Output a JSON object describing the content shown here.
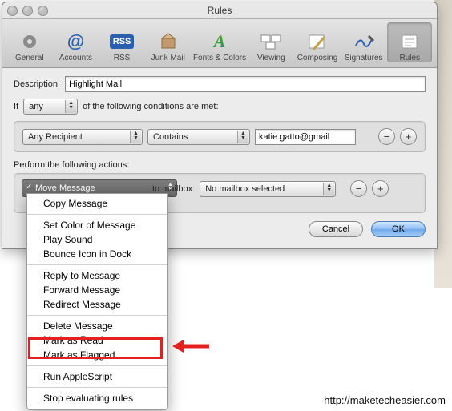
{
  "window": {
    "title": "Rules"
  },
  "toolbar": {
    "items": [
      {
        "label": "General"
      },
      {
        "label": "Accounts"
      },
      {
        "label": "RSS"
      },
      {
        "label": "Junk Mail"
      },
      {
        "label": "Fonts & Colors"
      },
      {
        "label": "Viewing"
      },
      {
        "label": "Composing"
      },
      {
        "label": "Signatures"
      },
      {
        "label": "Rules"
      }
    ]
  },
  "form": {
    "description_label": "Description:",
    "description_value": "Highlight Mail",
    "if_label": "If",
    "match_scope": "any",
    "conditions_suffix": "of the following conditions are met:",
    "condition": {
      "field": "Any Recipient",
      "operator": "Contains",
      "value": "katie.gatto@gmail"
    },
    "actions_label": "Perform the following actions:",
    "action_selected": "Move Message",
    "mailbox_prefix": "to mailbox:",
    "mailbox_value": "No mailbox selected",
    "minus": "−",
    "plus": "+"
  },
  "buttons": {
    "cancel": "Cancel",
    "ok": "OK"
  },
  "dropdown": {
    "groups": [
      [
        "Move Message",
        "Copy Message"
      ],
      [
        "Set Color of Message",
        "Play Sound",
        "Bounce Icon in Dock"
      ],
      [
        "Reply to Message",
        "Forward Message",
        "Redirect Message"
      ],
      [
        "Delete Message",
        "Mark as Read",
        "Mark as Flagged"
      ],
      [
        "Run AppleScript"
      ],
      [
        "Stop evaluating rules"
      ]
    ]
  },
  "watermark": "http://maketecheasier.com"
}
